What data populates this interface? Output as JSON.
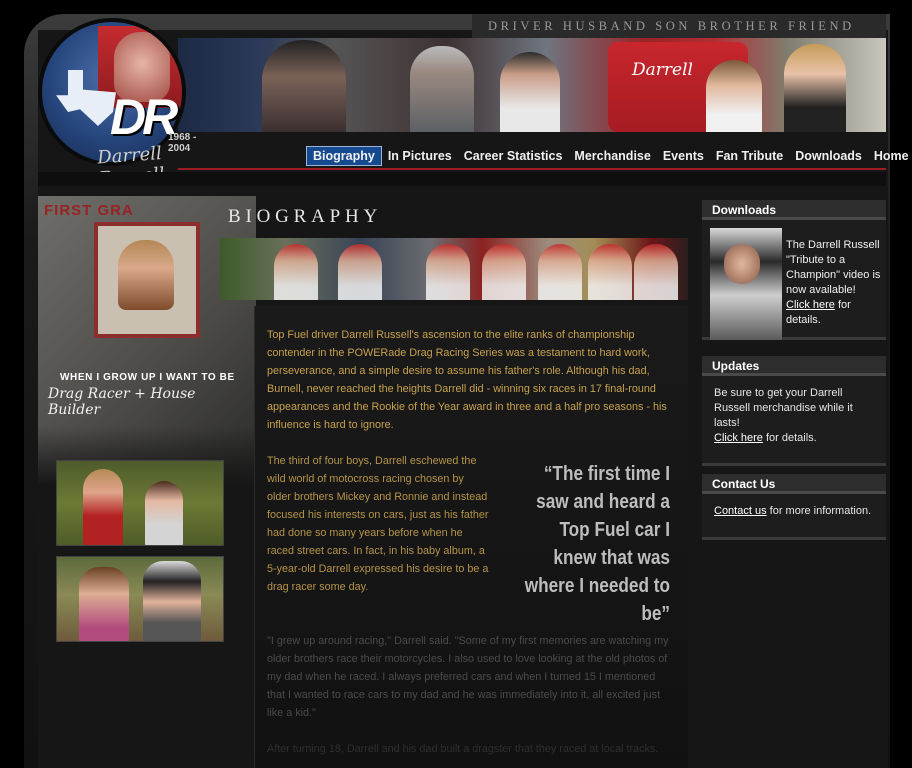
{
  "header": {
    "tagline": "DRIVER  HUSBAND  SON  BROTHER  FRIEND",
    "logo_text": "DR",
    "years": "1968 - 2004",
    "signature": "Darrell Russell",
    "banner_car_text": "Darrell"
  },
  "nav": {
    "items": [
      "Biography",
      "In Pictures",
      "Career Statistics",
      "Merchandise",
      "Events",
      "Fan Tribute",
      "Downloads",
      "Home"
    ],
    "active": "Biography"
  },
  "left": {
    "scrapbook_title": "FIRST GRA",
    "grow_up": "WHEN I GROW UP I WANT TO BE",
    "handwriting": "Drag Racer + House Builder"
  },
  "main": {
    "heading": "BIOGRAPHY",
    "para1": "Top Fuel driver Darrell Russell's ascension to the elite ranks of championship contender in the POWERade Drag Racing Series was a testament to hard work, perseverance, and a simple desire to assume his father's role. Although his dad, Burnell, never reached the heights Darrell did - winning six races in 17 final-round appearances and the Rookie of the Year award in three and a half pro seasons - his influence is hard to ignore.",
    "para2": "The third of four boys, Darrell eschewed the wild world of motocross racing chosen by older brothers Mickey and Ronnie and instead focused his interests on cars, just as his father had done so many years before when he raced street cars. In fact, in his baby album, a 5-year-old Darrell expressed his desire to be a drag racer some day.",
    "quote": "“The first time I saw and heard a Top Fuel car I knew that was where I needed to be”",
    "para3": "\"I grew up around racing,\" Darrell said. \"Some of my first memories are watching my older brothers race their motorcycles. I also used to love looking at the old photos of my dad when he raced. I always preferred cars and when I turned 15 I mentioned that I wanted to race cars to my dad and he was immediately into it, all excited just like a kid.\"",
    "para4": "After turning 18, Darrell and his dad built a dragster that they raced at local tracks."
  },
  "sidebar": {
    "downloads": {
      "title": "Downloads",
      "text": "The Darrell Russell \"Tribute to a Champion\" video is now available!",
      "link": "Click here",
      "suffix": " for details."
    },
    "updates": {
      "title": "Updates",
      "text": "Be sure to get your Darrell Russell merchandise while it lasts!",
      "link": "Click here",
      "suffix": " for details."
    },
    "contact": {
      "title": "Contact Us",
      "link": "Contact us",
      "suffix": " for more information."
    }
  }
}
